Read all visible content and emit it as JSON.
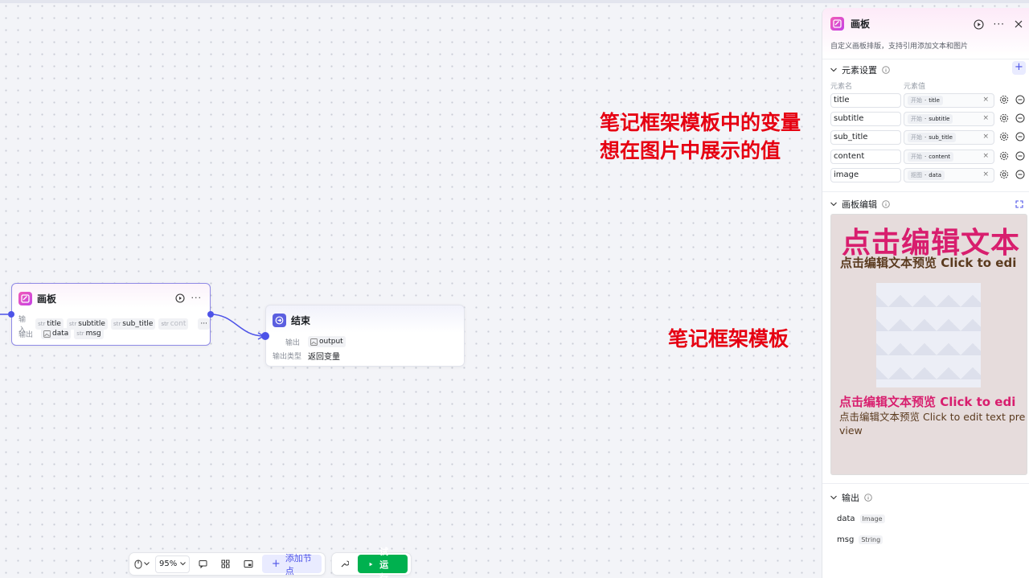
{
  "canvas": {
    "board_node": {
      "title": "画板",
      "input_label": "输入",
      "output_label": "输出",
      "inputs": [
        {
          "type": "str",
          "name": "title"
        },
        {
          "type": "str",
          "name": "subtitle"
        },
        {
          "type": "str",
          "name": "sub_title"
        },
        {
          "type": "str",
          "name": "cont"
        }
      ],
      "more": "···",
      "outputs": [
        {
          "type": "img",
          "name": "data"
        },
        {
          "type": "str",
          "name": "msg"
        }
      ]
    },
    "end_node": {
      "title": "结束",
      "output_label": "输出",
      "output_name": "output",
      "output_type_label": "输出类型",
      "output_type_value": "返回变量"
    },
    "annotations": {
      "line1": "笔记框架模板中的变量",
      "line2": "想在图片中展示的值",
      "frame": "笔记框架模板"
    }
  },
  "toolbar": {
    "zoom": "95%",
    "add_node": "添加节点",
    "run": "试运行"
  },
  "panel": {
    "title": "画板",
    "description": "自定义画板排版，支持引用添加文本和图片",
    "elements_section": "元素设置",
    "col_name": "元素名",
    "col_value": "元素值",
    "elements": [
      {
        "name": "title",
        "source": "开始",
        "value": "title"
      },
      {
        "name": "subtitle",
        "source": "开始",
        "value": "subtitle"
      },
      {
        "name": "sub_title",
        "source": "开始",
        "value": "sub_title"
      },
      {
        "name": "content",
        "source": "开始",
        "value": "content"
      },
      {
        "name": "image",
        "source": "抠图",
        "value": "data"
      }
    ],
    "board_section": "画板编辑",
    "preview": {
      "big": "点击编辑文本",
      "sub": "点击编辑文本预览 Click to edi",
      "pink": "点击编辑文本预览 Click to edi",
      "brown": "点击编辑文本预览 Click to edit text preview"
    },
    "output_section": "输出",
    "outputs": [
      {
        "name": "data",
        "type": "Image"
      },
      {
        "name": "msg",
        "type": "String"
      }
    ]
  }
}
